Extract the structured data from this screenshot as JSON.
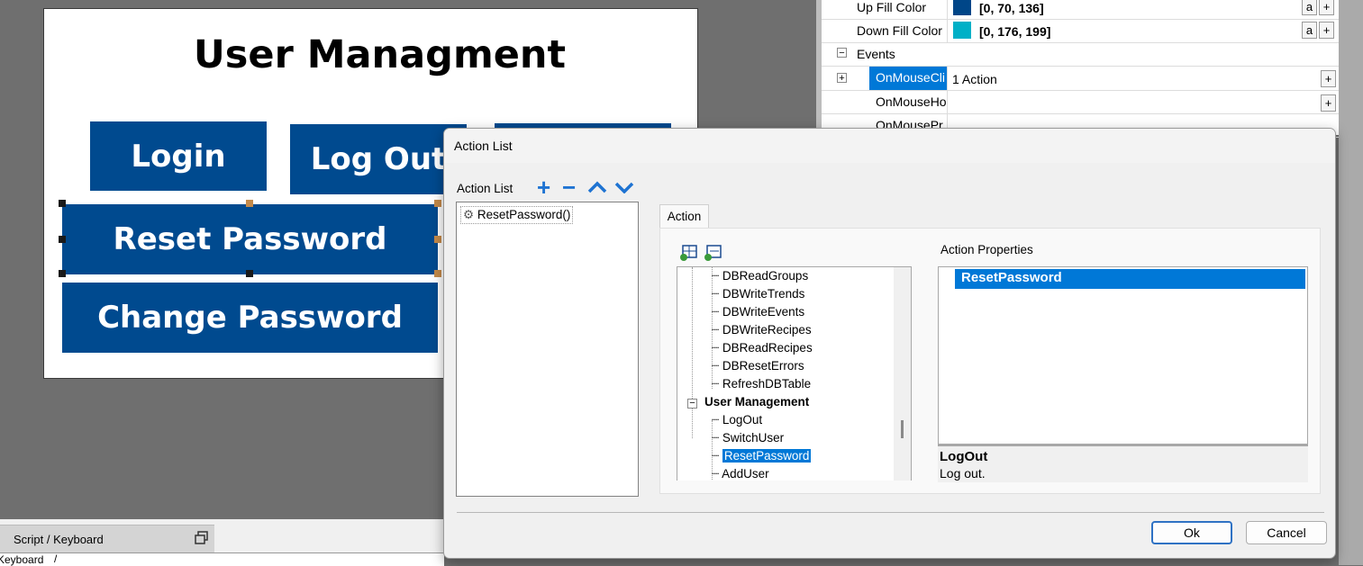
{
  "hmi": {
    "title": "User Managment",
    "login": "Login",
    "logout": "Log Out",
    "reset_password": "Reset Password",
    "change_password": "Change Password"
  },
  "bottom": {
    "tab_label": "Script / Keyboard",
    "keyboard_label": "Keyboard",
    "slash": "/"
  },
  "properties": {
    "up_fill": {
      "label": "Up Fill Color",
      "value": "[0, 70, 136]",
      "swatch": "#004688"
    },
    "down_fill": {
      "label": "Down Fill Color",
      "value": "[0, 176, 199]",
      "swatch": "#00b0c7"
    },
    "events_label": "Events",
    "on_mouse_click": {
      "label": "OnMouseCli",
      "value": "1 Action"
    },
    "on_mouse_hover": {
      "label": "OnMouseHo"
    },
    "on_mouse_press": {
      "label": "OnMousePr"
    },
    "a_button": "a",
    "plus_button": "+",
    "expand_symbol": "+",
    "collapse_symbol": "−"
  },
  "dialog": {
    "title": "Action List",
    "action_list_label": "Action List",
    "toolbar": {
      "add": "+",
      "remove": "−",
      "up": "^",
      "down": "v"
    },
    "actions": [
      "ResetPassword()"
    ],
    "tab_action": "Action",
    "tree_items": [
      "DBReadGroups",
      "DBWriteTrends",
      "DBWriteEvents",
      "DBWriteRecipes",
      "DBReadRecipes",
      "DBResetErrors",
      "RefreshDBTable"
    ],
    "tree_group": "User Management",
    "tree_group_toggle": "−",
    "tree_group_items": [
      "LogOut",
      "SwitchUser",
      "ResetPassword",
      "AddUser"
    ],
    "action_properties_label": "Action Properties",
    "selected_property": "ResetPassword",
    "description_title": "LogOut",
    "description_text": "Log out.",
    "ok_label": "Ok",
    "cancel_label": "Cancel"
  },
  "colors": {
    "hmi_button": "#004a8f",
    "selection": "#0078d7"
  }
}
